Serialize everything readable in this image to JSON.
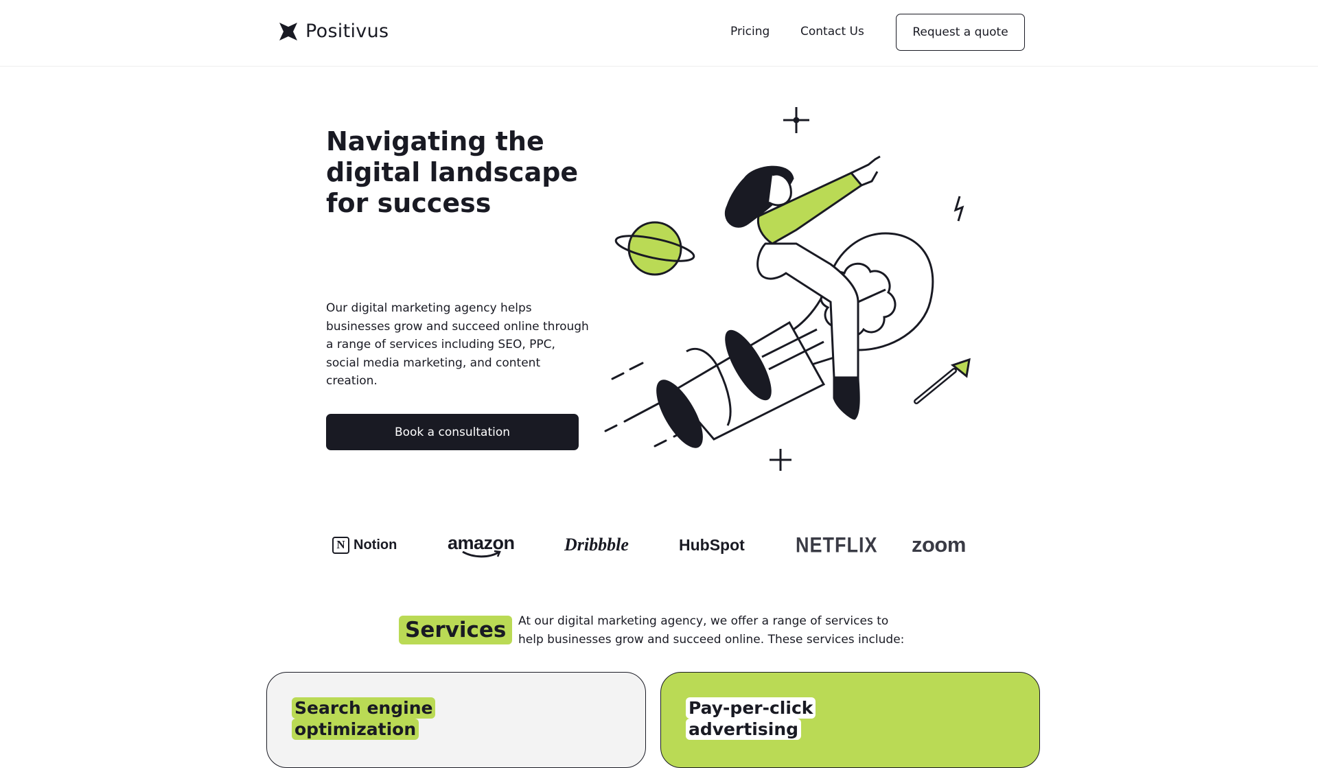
{
  "header": {
    "brand": "Positivus",
    "nav": {
      "pricing": "Pricing",
      "contact": "Contact Us"
    },
    "quote_button": "Request a quote"
  },
  "hero": {
    "title": "Navigating the digital landscape for success",
    "description": "Our digital marketing agency helps businesses grow and succeed online through a range of services including SEO, PPC, social media marketing, and content creation.",
    "cta": "Book a consultation"
  },
  "logos": {
    "notion": "Notion",
    "amazon": "amazon",
    "dribbble": "Dribbble",
    "hubspot": "HubSpot",
    "netflix": "NETFLIX",
    "zoom": "zoom"
  },
  "services": {
    "tag": "Services",
    "description": "At our digital marketing agency, we offer a range of services to help businesses grow and succeed online. These services include:",
    "cards": [
      {
        "line1": "Search engine",
        "line2": "optimization"
      },
      {
        "line1": "Pay-per-click",
        "line2": "advertising"
      }
    ]
  },
  "colors": {
    "accent": "#bada55",
    "dark": "#191A23",
    "card_grey": "#F3F3F3"
  }
}
